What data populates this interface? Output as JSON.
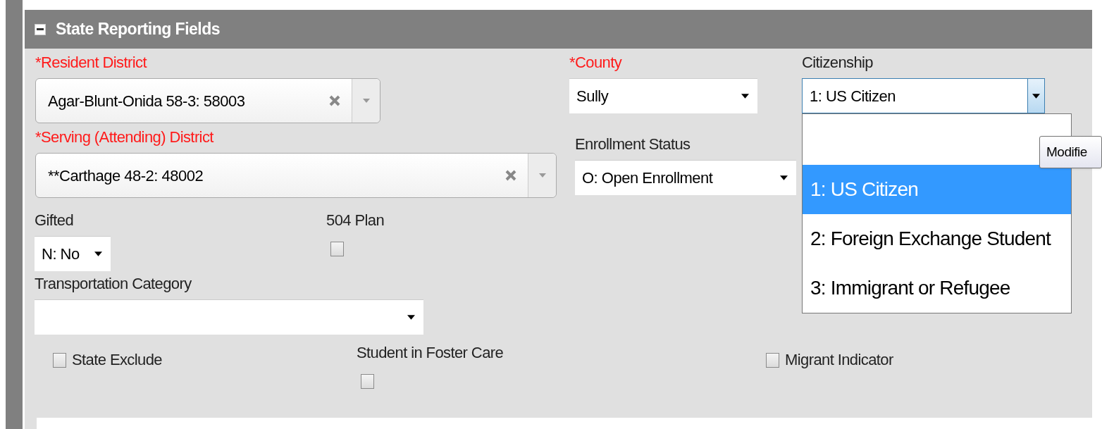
{
  "section": {
    "title": "State Reporting Fields",
    "expanded": true
  },
  "fields": [
    {
      "kind": "combobox",
      "label": "*Resident District",
      "required": true,
      "value": "Agar-Blunt-Onida 58-3: 58003"
    },
    {
      "kind": "select",
      "label": "*County",
      "required": true,
      "value": "Sully"
    },
    {
      "kind": "select",
      "label": "Citizenship",
      "required": false,
      "value": "1: US Citizen",
      "expanded": true,
      "options": [
        {
          "label": "1: US Citizen",
          "selected": true
        },
        {
          "label": "2: Foreign Exchange Student",
          "selected": false
        },
        {
          "label": "3: Immigrant or Refugee",
          "selected": false
        }
      ]
    },
    {
      "kind": "combobox",
      "label": "*Serving (Attending) District",
      "required": true,
      "value": "**Carthage 48-2: 48002"
    },
    {
      "kind": "select",
      "label": "Enrollment Status",
      "required": false,
      "value": "O: Open Enrollment"
    },
    {
      "kind": "select",
      "label": "Gifted",
      "required": false,
      "value": "N: No"
    },
    {
      "kind": "stackedcheckbox",
      "label": "504 Plan",
      "checked": false
    },
    {
      "kind": "select",
      "label": "Transportation Category",
      "required": false
    },
    {
      "kind": "checkbox",
      "label": "State Exclude",
      "checked": false
    },
    {
      "kind": "stackedcheckbox",
      "label": "Student in Foster Care",
      "checked": false
    },
    {
      "kind": "checkbox",
      "label": "Migrant Indicator",
      "checked": false
    }
  ],
  "tooltip": {
    "text": "Modifie"
  }
}
